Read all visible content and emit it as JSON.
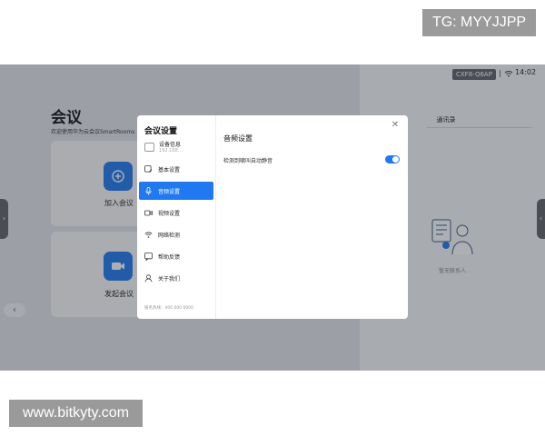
{
  "watermarks": {
    "top": "TG: MYYJJPP",
    "bottom": "www.bitkyty.com"
  },
  "status_bar": {
    "device_id": "CXF8-Q6AP",
    "separator": "|",
    "time": "14:02"
  },
  "main": {
    "title": "会议",
    "subtitle": "欢迎使用华为云会议SmartRooms",
    "join_label": "加入会议",
    "start_label": "发起会议"
  },
  "contacts": {
    "title": "通讯录",
    "empty_text": "暂无联系人"
  },
  "dialog": {
    "title": "会议设置",
    "device": {
      "name": "设备信息",
      "ip": "192.168..."
    },
    "menu": [
      {
        "label": "基本设置",
        "icon": "basic-settings-icon"
      },
      {
        "label": "音频设置",
        "icon": "microphone-icon"
      },
      {
        "label": "视频设置",
        "icon": "video-camera-icon"
      },
      {
        "label": "网络检测",
        "icon": "wifi-icon"
      },
      {
        "label": "帮助反馈",
        "icon": "help-feedback-icon"
      },
      {
        "label": "关于我们",
        "icon": "user-icon"
      }
    ],
    "active_index": 1,
    "footer": "服务热线：400 000 0000",
    "section_title": "音频设置",
    "setting_label": "检测到啸叫自动静音",
    "setting_enabled": true
  },
  "colors": {
    "accent": "#2079f0",
    "overlay": "rgba(40,44,52,0.38)"
  }
}
